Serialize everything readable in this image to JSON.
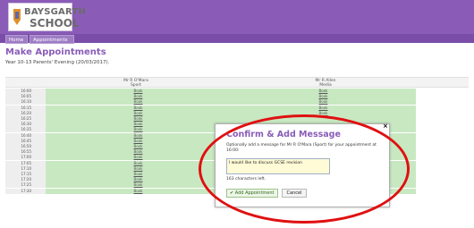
{
  "logo": {
    "line1": "BAYSGARTH",
    "line2": "SCHOOL",
    "brand_color": "#8a5cb8"
  },
  "nav": {
    "home": "Home",
    "appointments": "Appointments"
  },
  "page": {
    "title": "Make Appointments",
    "subtitle": "Year 10-13 Parents' Evening (20/03/2017)."
  },
  "columns": [
    {
      "teacher": "Mr R O'Mara",
      "subject": "Sport"
    },
    {
      "teacher": "Mr R Allen",
      "subject": "Media"
    }
  ],
  "rows": [
    {
      "time": "16:00",
      "c1": "Book",
      "c2": "Book"
    },
    {
      "time": "16:05",
      "c1": "Book",
      "c2": "Book"
    },
    {
      "time": "16:10",
      "c1": "Book",
      "c2": "Book"
    },
    {
      "time": "16:15",
      "c1": "Book",
      "c2": "Book"
    },
    {
      "time": "16:20",
      "c1": "Book",
      "c2": "Book"
    },
    {
      "time": "16:25",
      "c1": "Book",
      "c2": ""
    },
    {
      "time": "16:30",
      "c1": "Book",
      "c2": ""
    },
    {
      "time": "16:35",
      "c1": "Book",
      "c2": ""
    },
    {
      "time": "16:40",
      "c1": "Book",
      "c2": ""
    },
    {
      "time": "16:45",
      "c1": "Book",
      "c2": ""
    },
    {
      "time": "16:50",
      "c1": "Book",
      "c2": ""
    },
    {
      "time": "16:55",
      "c1": "Book",
      "c2": ""
    },
    {
      "time": "17:00",
      "c1": "Book",
      "c2": ""
    },
    {
      "time": "17:05",
      "c1": "Book",
      "c2": ""
    },
    {
      "time": "17:10",
      "c1": "Book",
      "c2": ""
    },
    {
      "time": "17:15",
      "c1": "Book",
      "c2": "Book"
    },
    {
      "time": "17:20",
      "c1": "Book",
      "c2": "Book"
    },
    {
      "time": "17:25",
      "c1": "Book",
      "c2": "Book"
    },
    {
      "time": "17:30",
      "c1": "Book",
      "c2": "Book"
    }
  ],
  "modal": {
    "title": "Confirm & Add Message",
    "description": "Optionally add a message for Mr R O'Mara (Sport) for your appointment at 16:00:",
    "message": "I would like to discuss GCSE revision",
    "chars_left": "163 characters left.",
    "add_label": "Add Appointment",
    "cancel_label": "Cancel",
    "close_symbol": "×"
  },
  "colors": {
    "slot_green": "#c8e8c2",
    "highlight_red": "#e01010"
  }
}
